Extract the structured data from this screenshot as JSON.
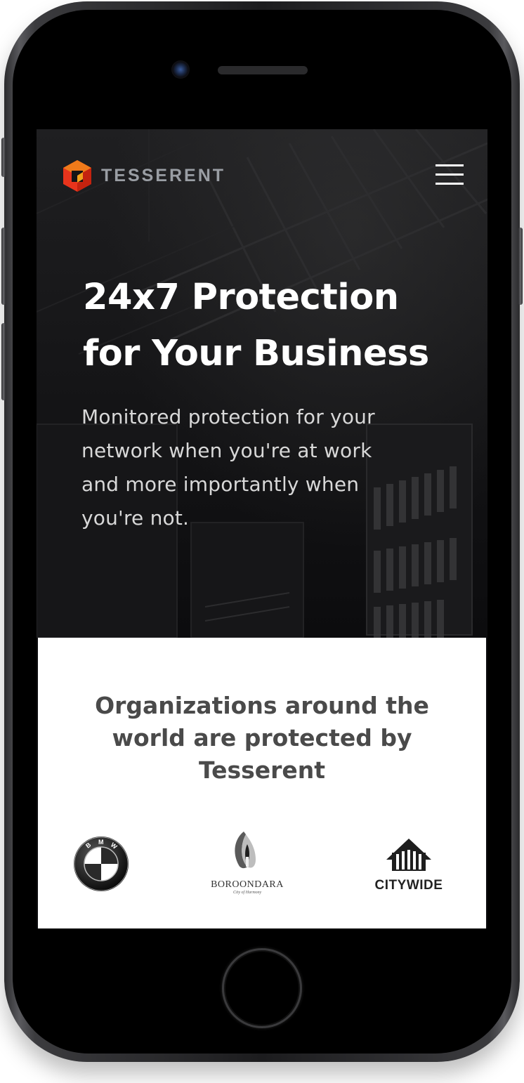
{
  "device": {
    "icons": {
      "camera": "camera-icon",
      "speaker": "speaker-grille",
      "home": "home-button"
    }
  },
  "header": {
    "brand_name": "TESSERENT",
    "logo_icon": "tesserent-cube-icon",
    "menu_icon": "hamburger-menu-icon",
    "brand_colors": {
      "logo_red": "#e8341c",
      "logo_orange": "#f07a1a",
      "brand_text": "#9a9ea4"
    }
  },
  "hero": {
    "title_line1": "24x7 Protection",
    "title_line2": "for Your Business",
    "subtitle_lines": [
      "Monitored protection for your",
      "network when you're at work",
      "and more importantly when",
      "you're not."
    ]
  },
  "clients": {
    "heading_lines": [
      "Organizations around the",
      "world are protected by",
      "Tesserent"
    ],
    "logos": [
      {
        "name": "BMW",
        "letters": [
          "B",
          "M",
          "W"
        ],
        "icon": "bmw-logo"
      },
      {
        "name": "BOROONDARA",
        "tagline": "City of Harmony",
        "icon": "boroondara-logo"
      },
      {
        "name": "CITYWIDE",
        "icon": "citywide-logo"
      }
    ]
  }
}
